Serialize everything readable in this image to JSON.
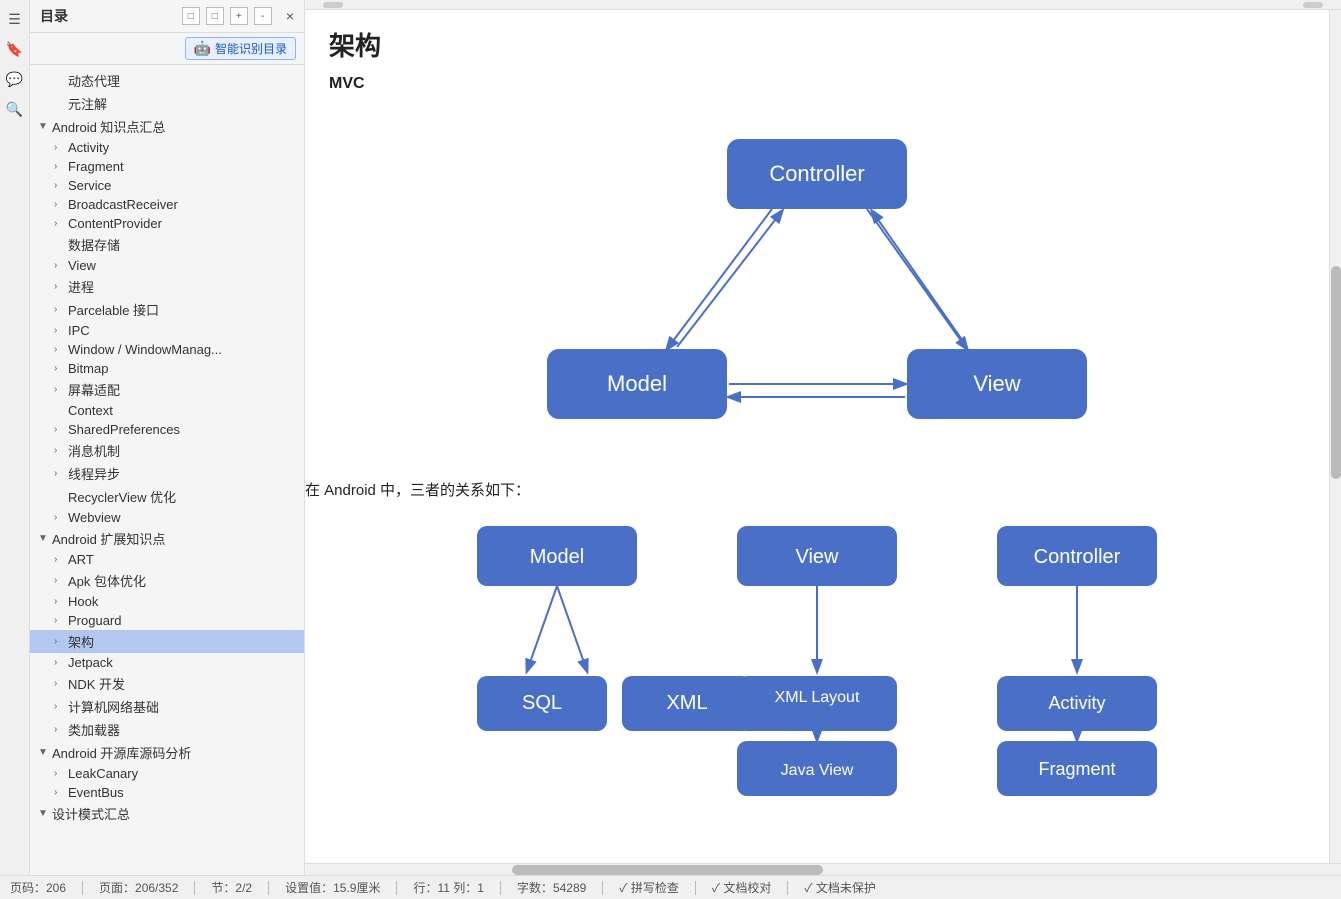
{
  "sidebar": {
    "title": "目录",
    "close_label": "×",
    "toolbar_icons": [
      "□",
      "□",
      "+",
      "-"
    ],
    "ai_button": "智能识别目录",
    "items": [
      {
        "label": "动态代理",
        "level": 1,
        "indent": 1,
        "hasArrow": false
      },
      {
        "label": "元注解",
        "level": 1,
        "indent": 1,
        "hasArrow": false
      },
      {
        "label": "Android 知识点汇总",
        "level": 0,
        "indent": 0,
        "hasArrow": true,
        "expanded": true
      },
      {
        "label": "Activity",
        "level": 1,
        "indent": 1,
        "hasArrow": true
      },
      {
        "label": "Fragment",
        "level": 1,
        "indent": 1,
        "hasArrow": true
      },
      {
        "label": "Service",
        "level": 1,
        "indent": 1,
        "hasArrow": true
      },
      {
        "label": "BroadcastReceiver",
        "level": 1,
        "indent": 1,
        "hasArrow": true
      },
      {
        "label": "ContentProvider",
        "level": 1,
        "indent": 1,
        "hasArrow": true
      },
      {
        "label": "数据存储",
        "level": 1,
        "indent": 1,
        "hasArrow": false
      },
      {
        "label": "View",
        "level": 1,
        "indent": 1,
        "hasArrow": true
      },
      {
        "label": "进程",
        "level": 1,
        "indent": 1,
        "hasArrow": true
      },
      {
        "label": "Parcelable 接口",
        "level": 1,
        "indent": 1,
        "hasArrow": true
      },
      {
        "label": "IPC",
        "level": 1,
        "indent": 1,
        "hasArrow": true
      },
      {
        "label": "Window / WindowManag...",
        "level": 1,
        "indent": 1,
        "hasArrow": true
      },
      {
        "label": "Bitmap",
        "level": 1,
        "indent": 1,
        "hasArrow": true
      },
      {
        "label": "屏幕适配",
        "level": 1,
        "indent": 1,
        "hasArrow": true
      },
      {
        "label": "Context",
        "level": 1,
        "indent": 1,
        "hasArrow": false
      },
      {
        "label": "SharedPreferences",
        "level": 1,
        "indent": 1,
        "hasArrow": true
      },
      {
        "label": "消息机制",
        "level": 1,
        "indent": 1,
        "hasArrow": true
      },
      {
        "label": "线程异步",
        "level": 1,
        "indent": 1,
        "hasArrow": true
      },
      {
        "label": "RecyclerView 优化",
        "level": 1,
        "indent": 1,
        "hasArrow": false
      },
      {
        "label": "Webview",
        "level": 1,
        "indent": 1,
        "hasArrow": true
      },
      {
        "label": "Android 扩展知识点",
        "level": 0,
        "indent": 0,
        "hasArrow": true,
        "expanded": true
      },
      {
        "label": "ART",
        "level": 1,
        "indent": 1,
        "hasArrow": true
      },
      {
        "label": "Apk 包体优化",
        "level": 1,
        "indent": 1,
        "hasArrow": true
      },
      {
        "label": "Hook",
        "level": 1,
        "indent": 1,
        "hasArrow": true
      },
      {
        "label": "Proguard",
        "level": 1,
        "indent": 1,
        "hasArrow": true
      },
      {
        "label": "架构",
        "level": 1,
        "indent": 1,
        "hasArrow": true,
        "selected": true
      },
      {
        "label": "Jetpack",
        "level": 1,
        "indent": 1,
        "hasArrow": true
      },
      {
        "label": "NDK 开发",
        "level": 1,
        "indent": 1,
        "hasArrow": true
      },
      {
        "label": "计算机网络基础",
        "level": 1,
        "indent": 1,
        "hasArrow": true
      },
      {
        "label": "类加载器",
        "level": 1,
        "indent": 1,
        "hasArrow": true
      },
      {
        "label": "Android 开源库源码分析",
        "level": 0,
        "indent": 0,
        "hasArrow": true,
        "expanded": true
      },
      {
        "label": "LeakCanary",
        "level": 1,
        "indent": 1,
        "hasArrow": true
      },
      {
        "label": "EventBus",
        "level": 1,
        "indent": 1,
        "hasArrow": true
      },
      {
        "label": "设计模式汇总",
        "level": 0,
        "indent": 0,
        "hasArrow": true,
        "expanded": true
      }
    ]
  },
  "content": {
    "title": "架构",
    "mvc_label": "MVC",
    "description": "在 Android 中，三者的关系如下：",
    "mvc_nodes": {
      "controller": "Controller",
      "model": "Model",
      "view": "View"
    },
    "android_mvc_nodes": {
      "model": "Model",
      "view": "View",
      "controller": "Controller",
      "sql": "SQL",
      "xml": "XML",
      "xml_layout": "XML Layout",
      "java_view": "Java View",
      "activity": "Activity",
      "fragment": "Fragment"
    }
  },
  "status_bar": {
    "page_info": "页码：206",
    "page_range": "页面：206/352",
    "section": "节：2/2",
    "position": "设置值：15.9厘米",
    "row_col": "行：11  列：1",
    "word_count": "字数：54289",
    "spelling": "✓ 拼写检查",
    "doc_check": "✓ 文档校对",
    "protection": "✓ 文档未保护"
  },
  "colors": {
    "mvc_box_fill": "#4a6fc7",
    "mvc_box_stroke": "#3a5ab0",
    "arrow_color": "#4a6fc7",
    "selected_bg": "#b3c8f0",
    "ai_btn_bg": "#e8f0fe",
    "ai_btn_text": "#1a56c4"
  }
}
